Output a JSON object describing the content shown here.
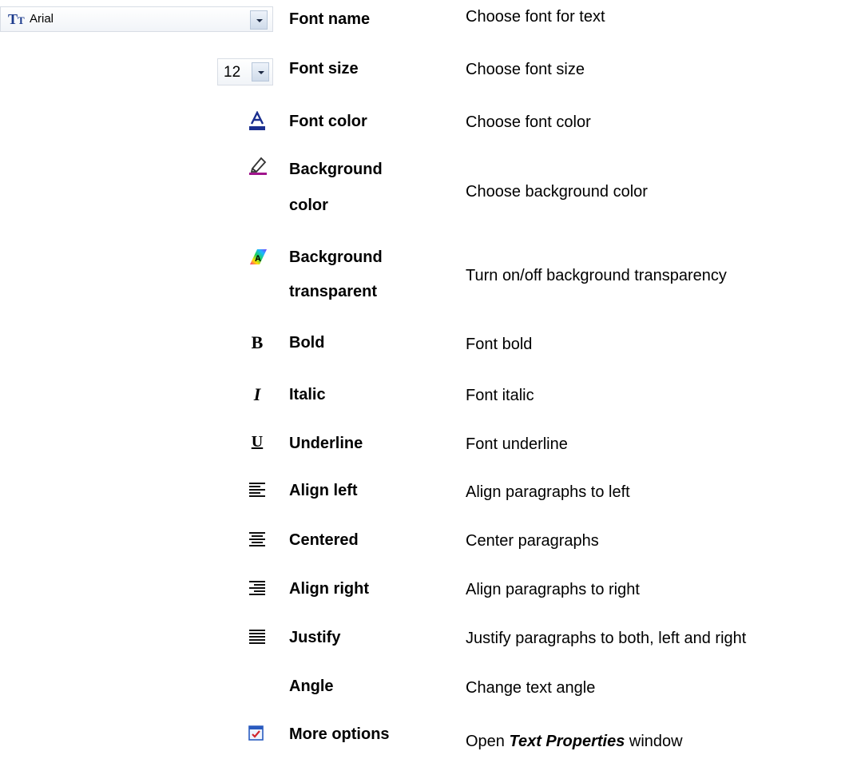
{
  "font_name_combo": {
    "value": "Arial",
    "icon": "font-tt-icon"
  },
  "font_size_combo": {
    "value": "12"
  },
  "rows": [
    {
      "name": "Font name",
      "desc": "Choose font for text"
    },
    {
      "name": "Font size",
      "desc": "Choose font size"
    },
    {
      "name": "Font color",
      "desc": "Choose font color",
      "icon": "font-color-icon"
    },
    {
      "name_line1": "Background",
      "name_line2": "color",
      "desc": "Choose background color",
      "icon": "highlighter-icon"
    },
    {
      "name_line1": "Background",
      "name_line2": "transparent",
      "desc": "Turn on/off background transparency",
      "icon": "transparent-bg-icon"
    },
    {
      "name": "Bold",
      "desc": "Font bold",
      "icon": "bold-icon"
    },
    {
      "name": "Italic",
      "desc": "Font italic",
      "icon": "italic-icon"
    },
    {
      "name": "Underline",
      "desc": "Font underline",
      "icon": "underline-icon"
    },
    {
      "name": "Align left",
      "desc": "Align paragraphs to left",
      "icon": "align-left-icon"
    },
    {
      "name": "Centered",
      "desc": "Center paragraphs",
      "icon": "align-center-icon"
    },
    {
      "name": "Align right",
      "desc": "Align paragraphs to right",
      "icon": "align-right-icon"
    },
    {
      "name": "Justify",
      "desc": "Justify paragraphs to both, left and right",
      "icon": "justify-icon"
    },
    {
      "name": "Angle",
      "desc": "Change text angle"
    },
    {
      "name": "More options",
      "desc_pre": "Open ",
      "desc_em": "Text Properties",
      "desc_post": " window",
      "icon": "more-options-icon"
    }
  ],
  "colors": {
    "font_color_bar": "#1b2f8f",
    "highlight_bar": "#a0148c"
  }
}
